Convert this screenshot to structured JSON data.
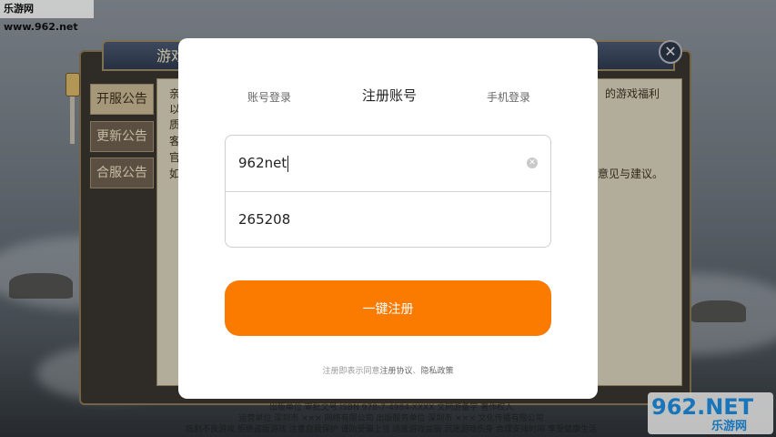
{
  "watermark": {
    "top_text": "乐游网 www.962.net",
    "logo_num": "962.NET",
    "logo_cn": "乐游网"
  },
  "notice": {
    "title": "游戏",
    "close_label": "✕",
    "tabs": [
      "开服公告",
      "更新公告",
      "合服公告"
    ],
    "active_tab_index": 0,
    "visible_text_left": [
      "亲",
      "以",
      "质",
      "客",
      "官",
      "如"
    ],
    "visible_text_right_1": "的游戏福利",
    "visible_text_right_2": "意见与建议。"
  },
  "legal_footer": [
    "出版单位 审批文号 ISBN 978-7-4984-XXXX 文网游备字 著作权人",
    "运营单位 深圳市 ××× 网络有限公司 出版服务单位 深圳市 ××× 文化传播有限公司",
    "抵制不良游戏 拒绝盗版游戏 注意自我保护 谨防受骗上当 适度游戏益脑 沉迷游戏伤身 合理安排时间 享受健康生活"
  ],
  "modal": {
    "tabs": [
      {
        "label": "账号登录",
        "active": false
      },
      {
        "label": "注册账号",
        "active": true
      },
      {
        "label": "手机登录",
        "active": false
      }
    ],
    "username": {
      "value": "962net"
    },
    "password": {
      "value": "265208"
    },
    "register_button": "一键注册",
    "terms": {
      "prefix": "注册即表示同意",
      "agreement": "注册协议",
      "separator": "、",
      "privacy": "隐私政策"
    }
  },
  "colors": {
    "accent": "#fb7a00"
  }
}
